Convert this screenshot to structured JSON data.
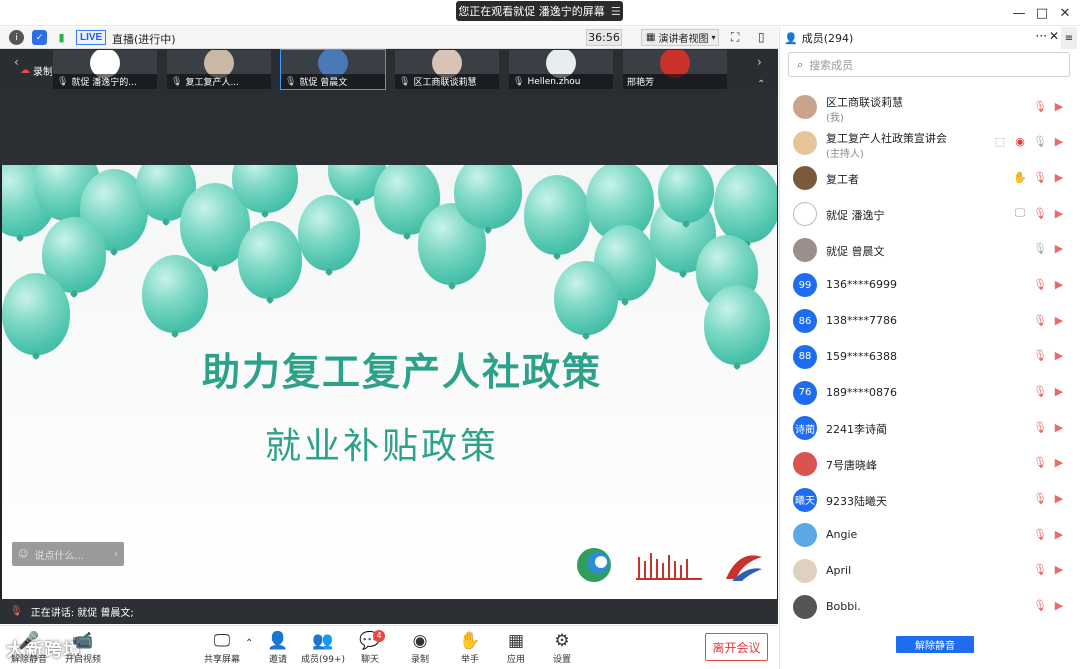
{
  "window": {
    "share_banner": "您正在观看就促 潘逸宁的屏幕",
    "minimize": "—",
    "maximize": "□",
    "close": "✕"
  },
  "meeting_top": {
    "live_badge": "LIVE",
    "live_status": "直播(进行中)",
    "timer": "36:56",
    "view_mode": "演讲者视图"
  },
  "thumbnails": [
    {
      "name": "就促 潘逸宁的..."
    },
    {
      "name": "复工复产人..."
    },
    {
      "name": "就促 曾晨文"
    },
    {
      "name": "区工商联谈莉慧"
    },
    {
      "name": "Hellen.zhou"
    },
    {
      "name": "邢艳芳"
    }
  ],
  "recording_label": "录制中",
  "slide": {
    "title": "助力复工复产人社政策",
    "subtitle": "就业补贴政策"
  },
  "chat_input": {
    "placeholder": "说点什么..."
  },
  "speaking": {
    "text": "正在讲话: 就促 曾晨文;"
  },
  "bottom_toolbar": {
    "watermark": "大新跨境",
    "mute_label": "解除静音",
    "video_label": "开启视频",
    "share_label": "共享屏幕",
    "invite_label": "邀请",
    "members_label": "成员(99+)",
    "chat_label": "聊天",
    "chat_badge": "4",
    "record_label": "录制",
    "raise_label": "举手",
    "apps_label": "应用",
    "settings_label": "设置",
    "leave_label": "离开会议"
  },
  "members_panel": {
    "title": "成员(294)",
    "search_placeholder": "搜索成员",
    "unmute_all": "解除静音",
    "members": [
      {
        "name": "区工商联谈莉慧",
        "sub": "(我)",
        "avatar_text": "",
        "avatar_color": "#c9a48a"
      },
      {
        "name": "复工复产人社政策宣讲会",
        "sub": "(主持人)",
        "avatar_text": "",
        "avatar_color": "#e8c49a"
      },
      {
        "name": "复工者",
        "sub": "",
        "avatar_text": "",
        "avatar_color": "#7a5a3a"
      },
      {
        "name": "就促 潘逸宁",
        "sub": "",
        "avatar_text": "",
        "avatar_color": "#ffffff"
      },
      {
        "name": "就促 曾晨文",
        "sub": "",
        "avatar_text": "",
        "avatar_color": "#9a8f8a"
      },
      {
        "name": "136****6999",
        "sub": "",
        "avatar_text": "99",
        "avatar_color": "#1e6cf0"
      },
      {
        "name": "138****7786",
        "sub": "",
        "avatar_text": "86",
        "avatar_color": "#1e6cf0"
      },
      {
        "name": "159****6388",
        "sub": "",
        "avatar_text": "88",
        "avatar_color": "#1e6cf0"
      },
      {
        "name": "189****0876",
        "sub": "",
        "avatar_text": "76",
        "avatar_color": "#1e6cf0"
      },
      {
        "name": "2241李诗蔺",
        "sub": "",
        "avatar_text": "诗蔺",
        "avatar_color": "#1e6cf0"
      },
      {
        "name": "7号唐晓峰",
        "sub": "",
        "avatar_text": "",
        "avatar_color": "#d9534f"
      },
      {
        "name": "9233陆曦天",
        "sub": "",
        "avatar_text": "曦天",
        "avatar_color": "#1e6cf0"
      },
      {
        "name": "Angie",
        "sub": "",
        "avatar_text": "",
        "avatar_color": "#5aa9e6"
      },
      {
        "name": "April",
        "sub": "",
        "avatar_text": "",
        "avatar_color": "#e0d0c0"
      },
      {
        "name": "Bobbi.",
        "sub": "",
        "avatar_text": "",
        "avatar_color": "#555555"
      }
    ]
  }
}
